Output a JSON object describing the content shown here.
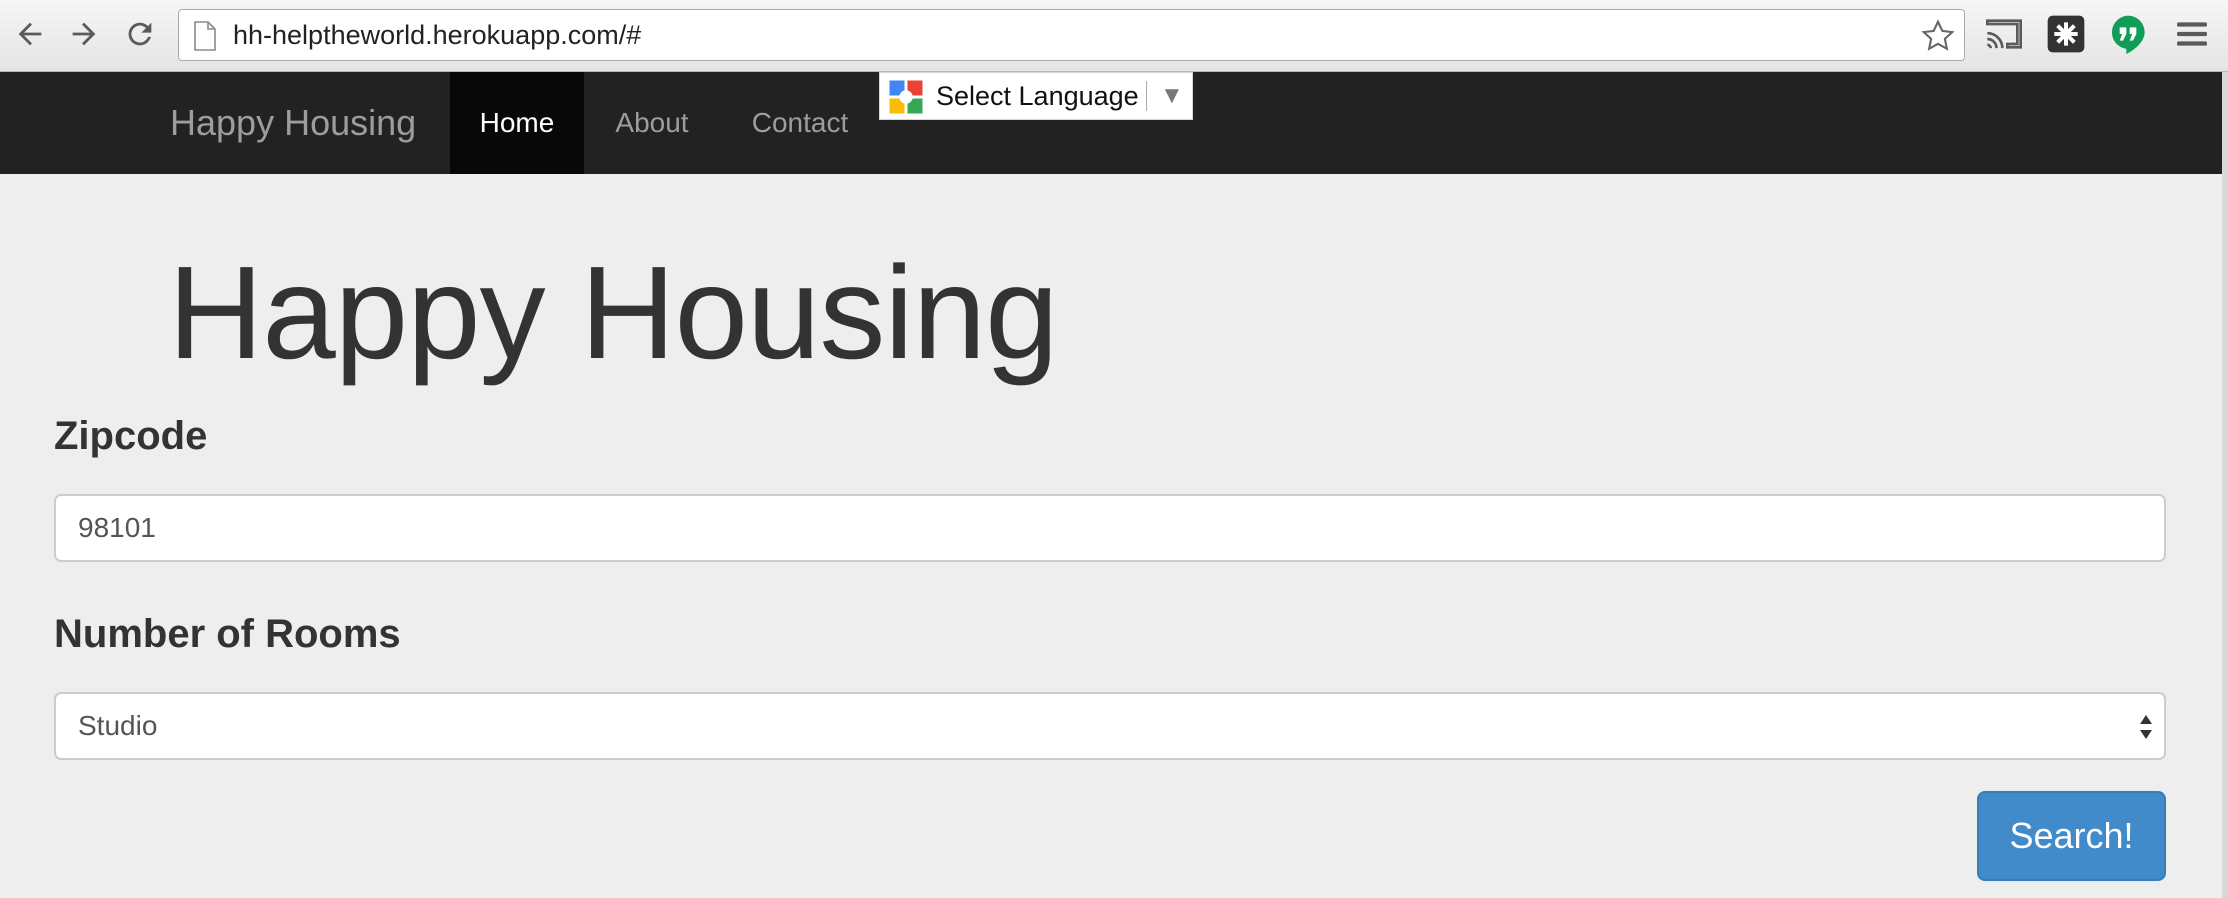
{
  "browser": {
    "url": "hh-helptheworld.herokuapp.com/#",
    "icons": {
      "back": "back-arrow-icon",
      "forward": "forward-arrow-icon",
      "reload": "reload-icon",
      "page": "page-icon",
      "bookmark": "star-icon",
      "cast": "cast-icon",
      "extension": "puzzle-extension-icon",
      "hangouts": "hangouts-icon",
      "menu": "hamburger-menu-icon"
    }
  },
  "navbar": {
    "brand": "Happy Housing",
    "items": [
      {
        "label": "Home",
        "active": true
      },
      {
        "label": "About",
        "active": false
      },
      {
        "label": "Contact",
        "active": false
      }
    ]
  },
  "translate_widget": {
    "label": "Select Language",
    "arrow": "▼"
  },
  "main": {
    "title": "Happy Housing",
    "zipcode": {
      "label": "Zipcode",
      "value": "98101"
    },
    "rooms": {
      "label": "Number of Rooms",
      "selected": "Studio"
    },
    "search_button": "Search!"
  },
  "colors": {
    "navbar_bg": "#222222",
    "active_nav_bg": "#080808",
    "page_bg": "#eeeeee",
    "button_primary": "#428bca",
    "hangouts_green": "#0f9d58"
  }
}
